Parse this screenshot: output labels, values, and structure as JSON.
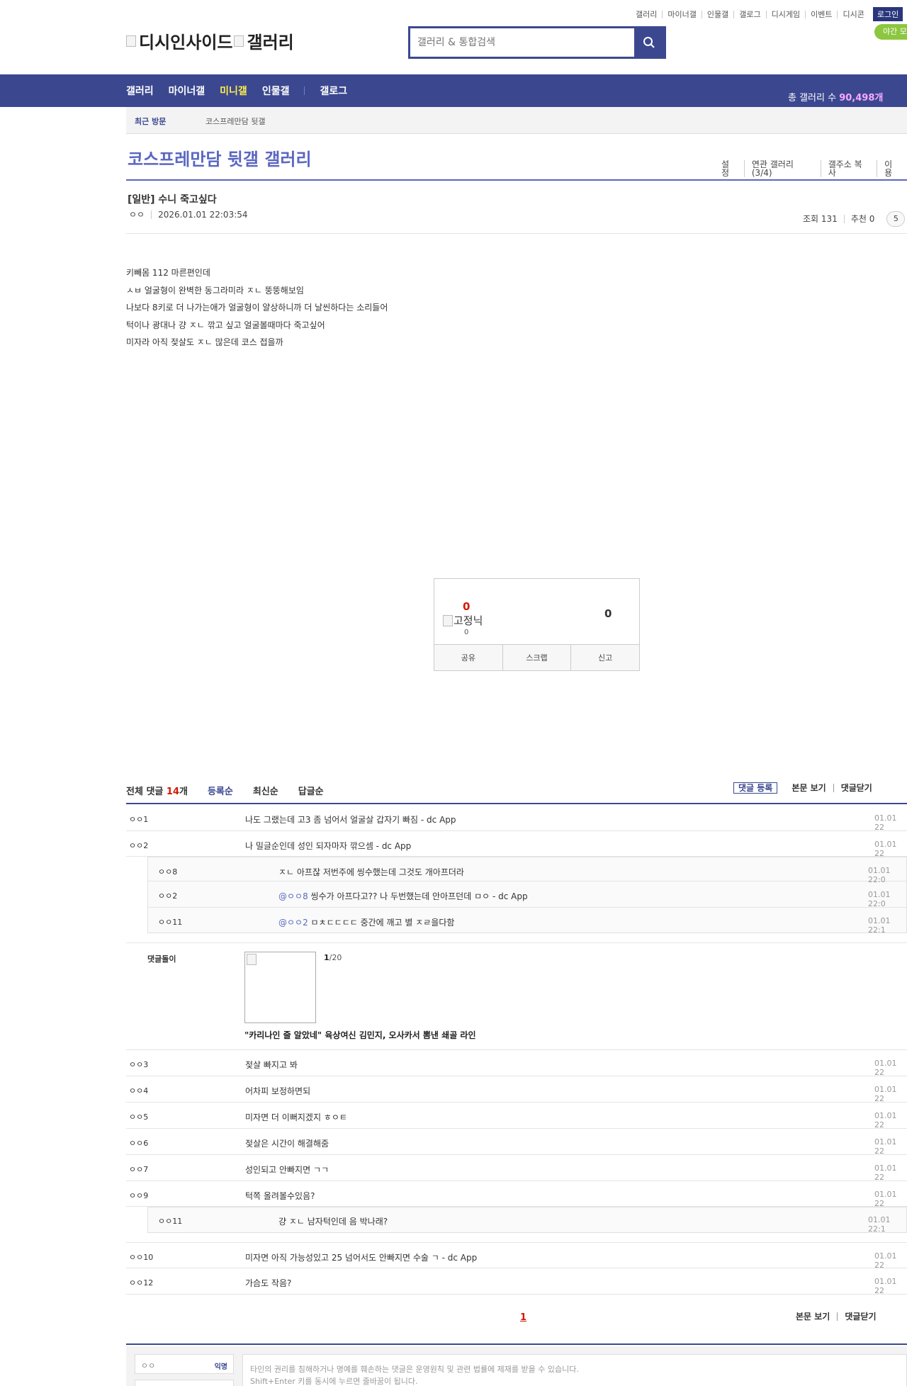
{
  "top_links": [
    "갤러리",
    "마이너갤",
    "인물갤",
    "갤로그",
    "디시게임",
    "이벤트",
    "디시콘"
  ],
  "login_label": "로그인",
  "night_label": "야간 모",
  "logo": {
    "left_alt": "디시인사이드",
    "right_alt": "갤러리"
  },
  "search": {
    "placeholder": "갤러리 & 통합검색",
    "icon": "search-icon"
  },
  "gnb": {
    "items": [
      "갤러리",
      "마이너갤",
      "미니갤",
      "인물갤",
      "갤로그"
    ],
    "active_index": 2,
    "total_label": "총 갤러리 수",
    "total_value": "90,498개"
  },
  "visit": {
    "label": "최근 방문",
    "recent": "코스프레만담 뒷갤"
  },
  "gallery": {
    "title": "코스프레만담 뒷갤 갤러리",
    "options": [
      "설정",
      "연관 갤러리(3/4)",
      "갤주소 복사",
      "이용"
    ]
  },
  "post": {
    "title": "[일반] 수니 죽고싶다",
    "author": "ㅇㅇ",
    "datetime": "2026.01.01 22:03:54",
    "views": "조회 131",
    "recommends": "추천 0",
    "comment_badge": "5",
    "body": [
      "키빼몸 112 마른편인데",
      "ㅅㅂ 얼굴형이 완벽한 동그라미라 ㅈㄴ 뚱뚱해보임",
      "나보다 8키로 더 나가는애가 얼굴형이 얄상하니까 더 날씬하다는 소리들어",
      " 턱이나 광대나 걍 ㅈㄴ 깎고 싶고 얼굴볼때마다 죽고싶어",
      "미자라 아직 젖살도 ㅈㄴ 많은데 코스 접을까"
    ]
  },
  "recommend": {
    "up": "0",
    "fix_alt": "고정닉",
    "fix_count": "0",
    "down": "0",
    "actions": [
      "공유",
      "스크랩",
      "신고"
    ]
  },
  "comments_header": {
    "total_prefix": "전체 댓글",
    "total_count": "14",
    "total_suffix": "개",
    "sorts": [
      "등록순",
      "최신순",
      "답글순"
    ],
    "tools": [
      "댓글 등록",
      "본문 보기",
      "댓글닫기"
    ]
  },
  "comments": [
    {
      "nick": "ㅇㅇ1",
      "text": "나도 그랬는데 고3 좀 넘어서 얼굴살 갑자기 빠짐 - dc App",
      "date": "01.01 22"
    },
    {
      "nick": "ㅇㅇ2",
      "text": "나 밀글순인데 성인 되자마자 깎으셈 - dc App",
      "date": "01.01 22"
    },
    {
      "nick": "ㅇㅇ3",
      "text": "젖살 빠지고 봐",
      "date": "01.01 22"
    },
    {
      "nick": "ㅇㅇ4",
      "text": "어차피 보정하면되",
      "date": "01.01 22"
    },
    {
      "nick": "ㅇㅇ5",
      "text": "미자면 더 이뻐지겠지 ㅎㅇㅌ",
      "date": "01.01 22"
    },
    {
      "nick": "ㅇㅇ6",
      "text": "젖살은 시간이 해결해줌",
      "date": "01.01 22"
    },
    {
      "nick": "ㅇㅇ7",
      "text": "성인되고 안빠지면 ㄱㄱ",
      "date": "01.01 22"
    },
    {
      "nick": "ㅇㅇ9",
      "text": "턱쪽 올려볼수있음?",
      "date": "01.01 22"
    },
    {
      "nick": "ㅇㅇ10",
      "text": "미자면 아직 가능성있고 25 넘어서도 안빠지면 수술 ㄱ - dc App",
      "date": "01.01 22"
    },
    {
      "nick": "ㅇㅇ12",
      "text": "가슴도 작음?",
      "date": "01.01 22"
    }
  ],
  "replies_a": [
    {
      "nick": "ㅇㅇ8",
      "mention": "",
      "text": "ㅈㄴ 아프잖 저번주에 씽수했는데 그것도 개아프더라",
      "date": "01.01 22:0"
    },
    {
      "nick": "ㅇㅇ2",
      "mention": "@ㅇㅇ8",
      "text": " 씽수가 아프다고?? 나 두번했는데 안아프던데 ㅁㅇ - dc App",
      "date": "01.01 22:0"
    },
    {
      "nick": "ㅇㅇ11",
      "mention": "@ㅇㅇ2",
      "text": " ㅁㅊㄷㄷㄷㄷ 중간에 깨고 별 ㅈㄹ을다함",
      "date": "01.01 22:1"
    }
  ],
  "replies_b": [
    {
      "nick": "ㅇㅇ11",
      "text": "걍 ㅈㄴ 남자턱인데 음 박나래?",
      "date": "01.01 22:1"
    }
  ],
  "dolgi": {
    "label": "댓글돌이",
    "page_current": "1",
    "page_total": "/20",
    "headline": "\"카리나인 줄 알았네\" 육상여신 김민지, 오사카서 뽐낸 쇄골 라인"
  },
  "pagination": {
    "current": "1"
  },
  "bottom_tools": [
    "본문 보기",
    "댓글닫기"
  ],
  "write": {
    "nick_value": "ㅇㅇ",
    "anon_label": "익명",
    "placeholder_line1": "타인의 권리를 침해하거나 명예를 훼손하는 댓글은 운영원칙 및 관련 법률에 제재를 받을 수 있습니다.",
    "placeholder_line2": "Shift+Enter 키를 동시에 누르면 줄바꿈이 됩니다."
  },
  "colors": {
    "brand": "#3b4890",
    "accent_title": "#5a67c1",
    "red": "#d31900",
    "night_button": "#8dc63f"
  }
}
